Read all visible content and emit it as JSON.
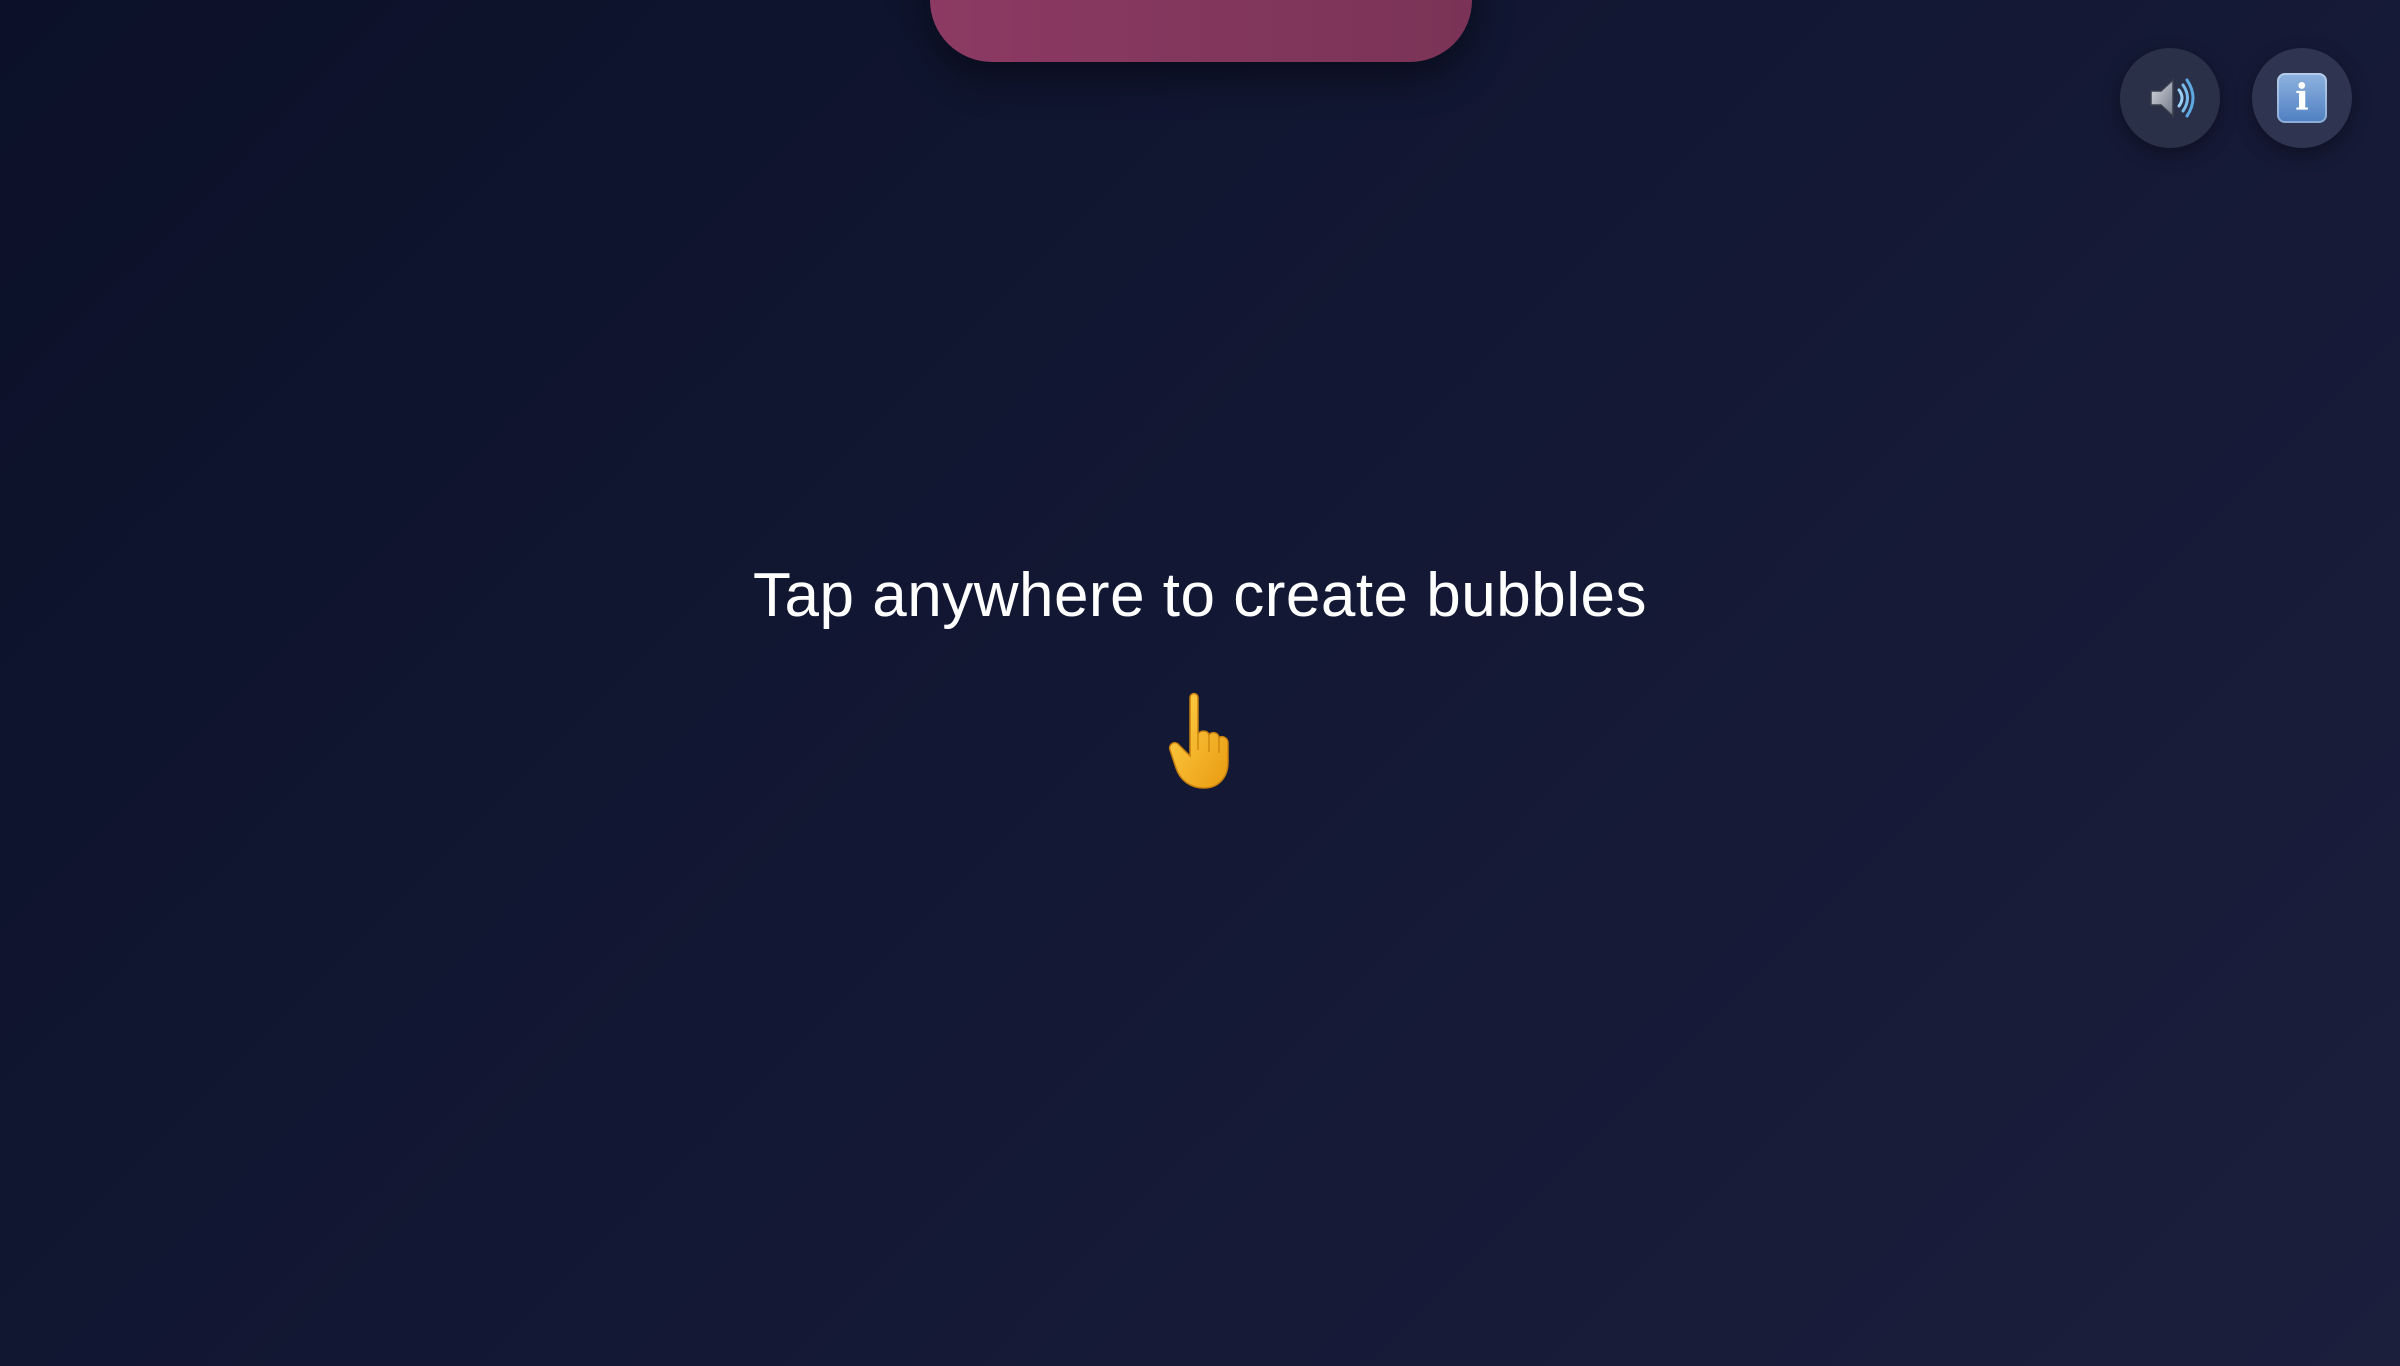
{
  "banner": {
    "label": "",
    "color_from": "#8c3a63",
    "color_to": "#7a3356"
  },
  "controls": {
    "sound_icon": "speaker-icon",
    "info_icon": "info-icon",
    "info_glyph": "i"
  },
  "main": {
    "prompt": "Tap anywhere to create bubbles",
    "pointer_icon": "pointing-up-hand-icon"
  },
  "colors": {
    "background": "#0c1129",
    "button_bg": "#2a3047",
    "text": "#ffffff",
    "hand": "#f5b81c"
  }
}
